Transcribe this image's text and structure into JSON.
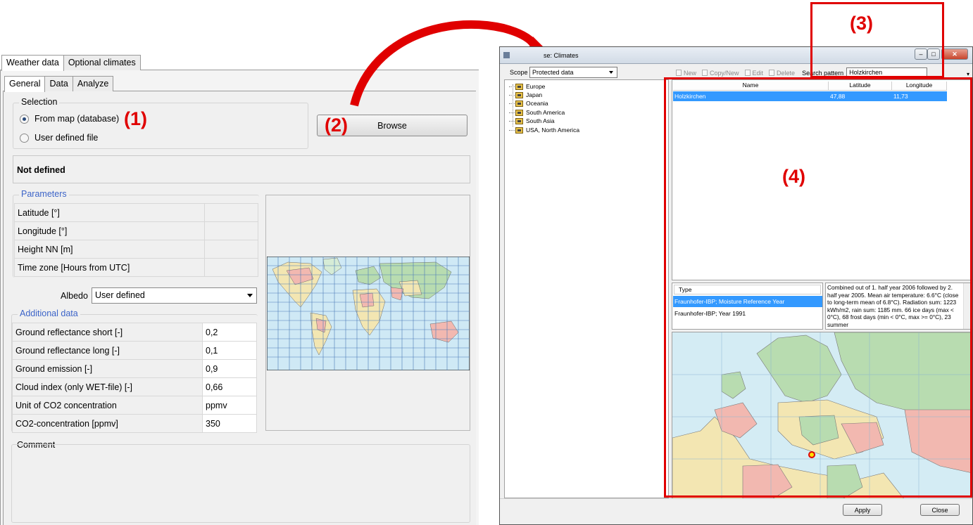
{
  "left_panel": {
    "main_tabs": [
      "Weather data",
      "Optional climates"
    ],
    "sub_tabs": [
      "General",
      "Data",
      "Analyze"
    ],
    "selection": {
      "title": "Selection",
      "options": [
        "From map (database)",
        "User defined file"
      ],
      "selected_index": 0
    },
    "browse_label": "Browse",
    "status": "Not defined",
    "parameters": {
      "title": "Parameters",
      "rows": [
        {
          "label": "Latitude  [°]",
          "value": ""
        },
        {
          "label": "Longitude  [°]",
          "value": ""
        },
        {
          "label": "Height NN  [m]",
          "value": ""
        },
        {
          "label": "Time zone  [Hours from UTC]",
          "value": ""
        }
      ]
    },
    "albedo": {
      "label": "Albedo",
      "value": "User defined"
    },
    "additional": {
      "title": "Additional data",
      "rows": [
        {
          "label": "Ground reflectance short  [-]",
          "value": "0,2"
        },
        {
          "label": "Ground reflectance long  [-]",
          "value": "0,1"
        },
        {
          "label": "Ground emission  [-]",
          "value": "0,9"
        },
        {
          "label": "Cloud index (only WET-file)  [-]",
          "value": "0,66"
        },
        {
          "label": "Unit of CO2 concentration",
          "value": "ppmv"
        },
        {
          "label": "CO2-concentration  [ppmv]",
          "value": "350"
        }
      ]
    },
    "comment_title": "Comment"
  },
  "annotations": {
    "a1": "(1)",
    "a2": "(2)",
    "a3": "(3)",
    "a4": "(4)"
  },
  "dialog": {
    "title": "se: Climates",
    "scope_label": "Scope",
    "scope_value": "Protected data",
    "tree": [
      "Europe",
      "Japan",
      "Oceania",
      "South America",
      "South Asia",
      "USA, North America"
    ],
    "toolbar": {
      "new": "New",
      "copy": "Copy/New",
      "edit": "Edit",
      "delete": "Delete",
      "search_label": "Search pattern",
      "search_value": "Holzkirchen"
    },
    "results": {
      "columns": [
        "Name",
        "Latitude",
        "Longitude"
      ],
      "rows": [
        {
          "name": "Holzkirchen",
          "lat": "47,88",
          "lon": "11,73"
        }
      ]
    },
    "type_header": "Type",
    "types": [
      "Fraunhofer-IBP; Moisture Reference Year",
      "Fraunhofer-IBP; Year 1991"
    ],
    "description": "Combined out of 1. half year 2006 followed by 2. half year 2005. Mean air temperature: 6.6°C (close to long-term mean of 6.8°C). Radiation sum: 1223 kWh/m2, rain sum: 1185 mm. 66 ice days (max < 0°C), 68 frost days (min < 0°C, max >= 0°C), 23 summer",
    "apply_label": "Apply",
    "close_label": "Close"
  },
  "colors": {
    "annotation": "#e00000",
    "selection": "#3399ff",
    "group_title": "#3c64c8"
  }
}
